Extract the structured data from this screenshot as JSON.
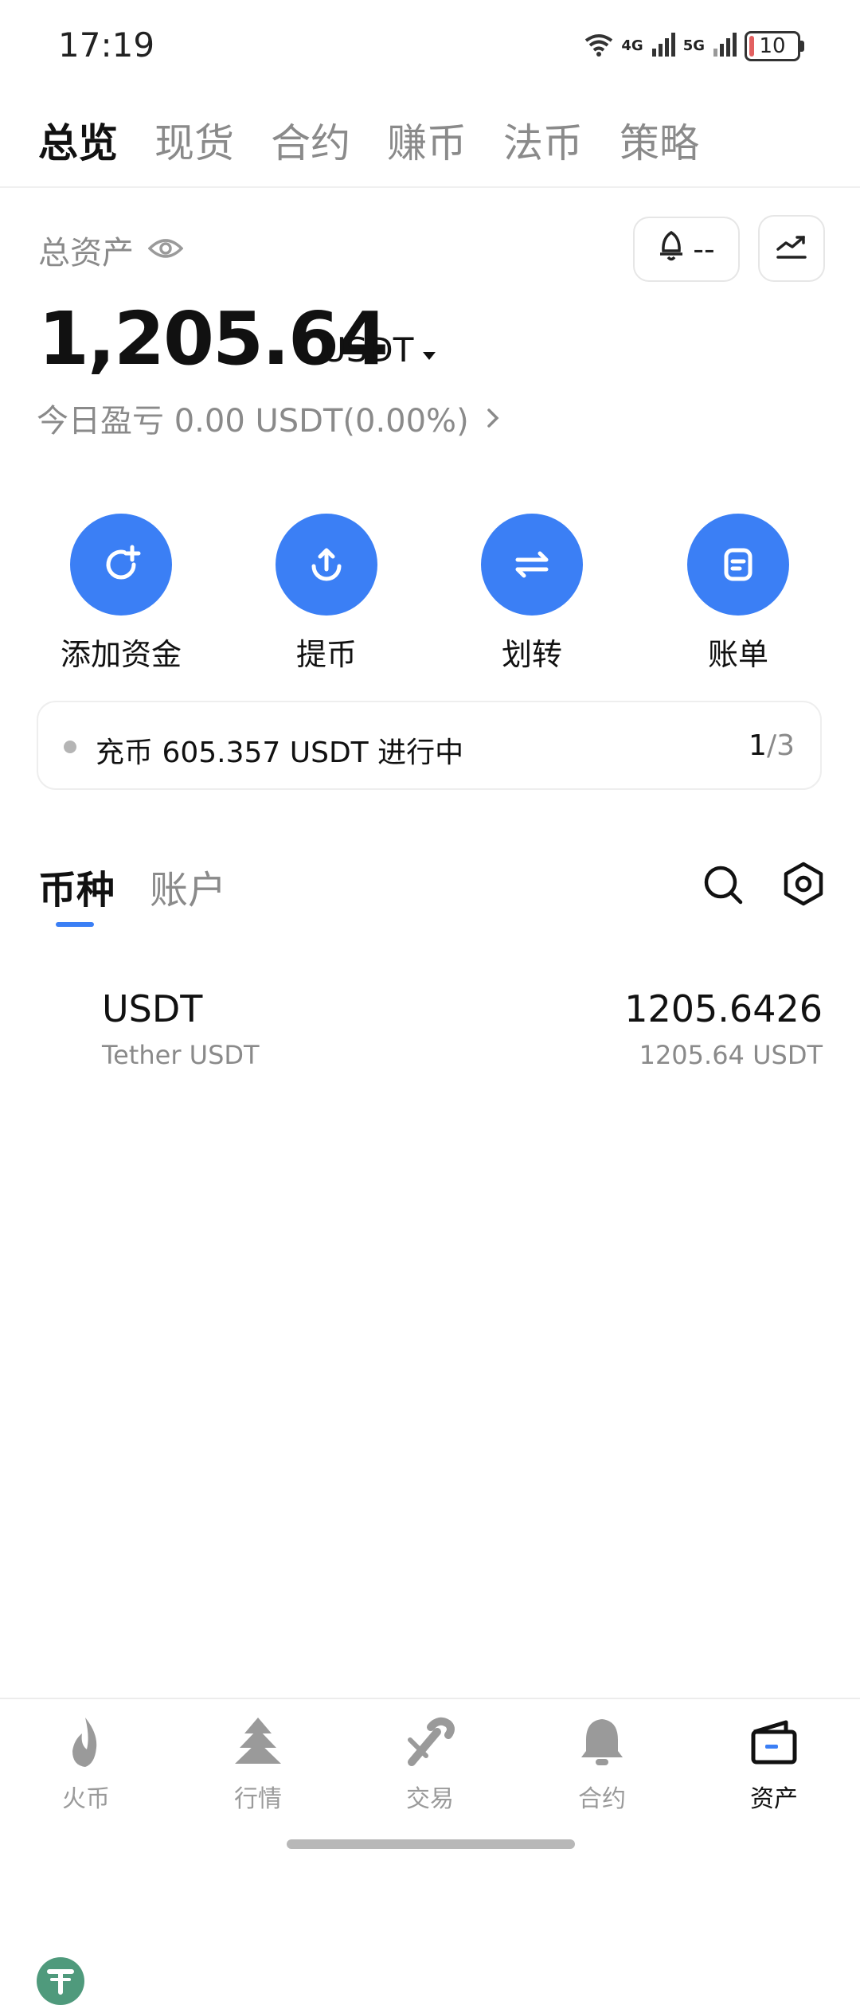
{
  "status_bar": {
    "time": "17:19",
    "net1": "4G",
    "net2": "5G",
    "battery": "10",
    "battery_level": 0.1
  },
  "top_tabs": [
    {
      "label": "总览",
      "active": true
    },
    {
      "label": "现货",
      "active": false
    },
    {
      "label": "合约",
      "active": false
    },
    {
      "label": "赚币",
      "active": false
    },
    {
      "label": "法币",
      "active": false
    },
    {
      "label": "策略",
      "active": false
    }
  ],
  "assets": {
    "total_label": "总资产",
    "balance": "1,205.64",
    "unit": "USDT",
    "pnl": "今日盈亏 0.00 USDT(0.00%)",
    "alert_text": "--"
  },
  "actions": [
    {
      "label": "添加资金",
      "icon": "add-funds-icon"
    },
    {
      "label": "提币",
      "icon": "withdraw-icon"
    },
    {
      "label": "划转",
      "icon": "transfer-icon"
    },
    {
      "label": "账单",
      "icon": "bill-icon"
    }
  ],
  "notice": {
    "text": "充币 605.357 USDT 进行中",
    "page_current": "1",
    "page_total": "/3"
  },
  "sub_tabs": [
    {
      "label": "币种",
      "active": true
    },
    {
      "label": "账户",
      "active": false
    }
  ],
  "coins": [
    {
      "symbol": "USDT",
      "name": "Tether USDT",
      "amount": "1205.6426",
      "value": "1205.64 USDT"
    }
  ],
  "bottom_nav": [
    {
      "label": "火币",
      "icon": "flame-icon",
      "active": false
    },
    {
      "label": "行情",
      "icon": "tree-icon",
      "active": false
    },
    {
      "label": "交易",
      "icon": "candy-icon",
      "active": false
    },
    {
      "label": "合约",
      "icon": "bell-icon",
      "active": false
    },
    {
      "label": "资产",
      "icon": "wallet-icon",
      "active": true
    }
  ],
  "colors": {
    "accent": "#3b7ff5",
    "tether": "#4f9a7c",
    "muted": "#8a8a8a"
  }
}
